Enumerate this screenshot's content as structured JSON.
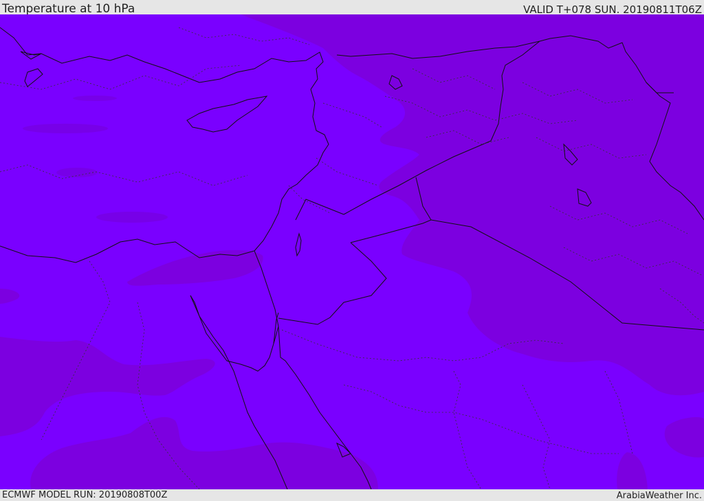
{
  "header": {
    "title": "Temperature at 10 hPa",
    "valid_time": "VALID T+078 SUN. 20190811T06Z"
  },
  "footer": {
    "model_run": "ECMWF MODEL RUN: 20190808T00Z",
    "credit": "ArabiaWeather Inc."
  },
  "map": {
    "colors": {
      "field_light": "#7a00ff",
      "field_dark": "#7c00e0",
      "field_darker": "#7600d6",
      "border_line": "#111111",
      "internal_border": "#333333"
    }
  }
}
